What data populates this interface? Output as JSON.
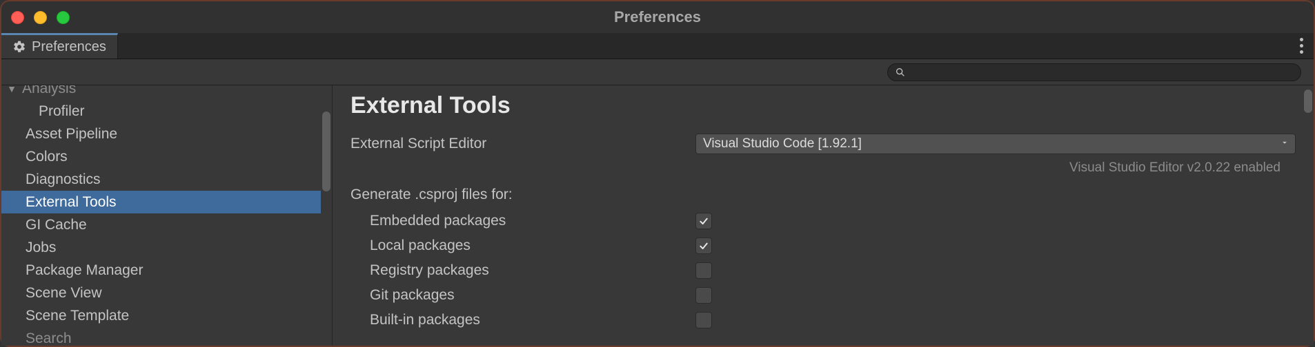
{
  "window": {
    "title": "Preferences"
  },
  "tab": {
    "label": "Preferences"
  },
  "sidebar": {
    "items": [
      {
        "label": "Analysis",
        "depth": 0,
        "hasChevron": true,
        "chevron": "▼",
        "selected": false,
        "cut": true
      },
      {
        "label": "Profiler",
        "depth": 1,
        "hasChevron": false,
        "selected": false
      },
      {
        "label": "Asset Pipeline",
        "depth": 0,
        "hasChevron": false,
        "selected": false
      },
      {
        "label": "Colors",
        "depth": 0,
        "hasChevron": false,
        "selected": false
      },
      {
        "label": "Diagnostics",
        "depth": 0,
        "hasChevron": false,
        "selected": false
      },
      {
        "label": "External Tools",
        "depth": 0,
        "hasChevron": false,
        "selected": true
      },
      {
        "label": "GI Cache",
        "depth": 0,
        "hasChevron": false,
        "selected": false
      },
      {
        "label": "Jobs",
        "depth": 0,
        "hasChevron": false,
        "selected": false
      },
      {
        "label": "Package Manager",
        "depth": 0,
        "hasChevron": false,
        "selected": false
      },
      {
        "label": "Scene View",
        "depth": 0,
        "hasChevron": false,
        "selected": false
      },
      {
        "label": "Scene Template",
        "depth": 0,
        "hasChevron": false,
        "selected": false
      },
      {
        "label": "Search",
        "depth": 0,
        "hasChevron": false,
        "selected": false,
        "cut": true
      }
    ]
  },
  "panel": {
    "title": "External Tools",
    "editorLabel": "External Script Editor",
    "editorValue": "Visual Studio Code [1.92.1]",
    "status": "Visual Studio Editor v2.0.22 enabled",
    "csprojLabel": "Generate .csproj files for:",
    "options": [
      {
        "label": "Embedded packages",
        "checked": true
      },
      {
        "label": "Local packages",
        "checked": true
      },
      {
        "label": "Registry packages",
        "checked": false
      },
      {
        "label": "Git packages",
        "checked": false
      },
      {
        "label": "Built-in packages",
        "checked": false
      }
    ]
  },
  "search": {
    "placeholder": ""
  }
}
